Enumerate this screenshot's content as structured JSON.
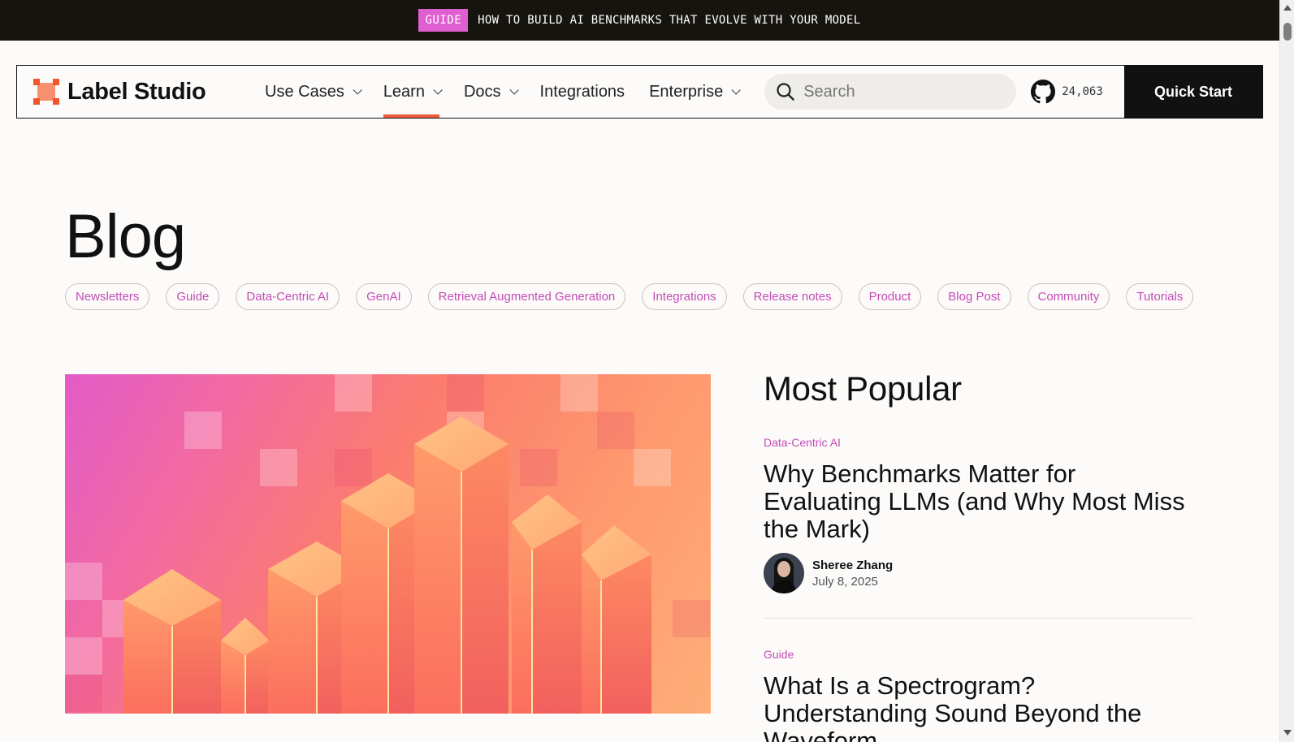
{
  "announcement": {
    "tag": "GUIDE",
    "message": "HOW TO BUILD AI BENCHMARKS THAT EVOLVE WITH YOUR MODEL"
  },
  "nav": {
    "brand": "Label Studio",
    "menu": [
      {
        "label": "Use Cases",
        "dropdown": true
      },
      {
        "label": "Learn",
        "dropdown": true,
        "active": true
      },
      {
        "label": "Docs",
        "dropdown": true
      },
      {
        "label": "Integrations",
        "dropdown": false
      },
      {
        "label": "Enterprise",
        "dropdown": true
      }
    ],
    "search_placeholder": "Search",
    "github_stars": "24,063",
    "cta": "Quick Start"
  },
  "page": {
    "title": "Blog",
    "tags": [
      "Newsletters",
      "Guide",
      "Data-Centric AI",
      "GenAI",
      "Retrieval Augmented Generation",
      "Integrations",
      "Release notes",
      "Product",
      "Blog Post",
      "Community",
      "Tutorials"
    ]
  },
  "popular": {
    "heading": "Most Popular",
    "posts": [
      {
        "category": "Data-Centric AI",
        "title": "Why Benchmarks Matter for Evaluating LLMs (and Why Most Miss the Mark)",
        "author": "Sheree Zhang",
        "date": "July 8, 2025"
      },
      {
        "category": "Guide",
        "title": "What Is a Spectrogram? Understanding Sound Beyond the Waveform"
      }
    ]
  },
  "colors": {
    "accent_pink": "#c34bb5",
    "accent_orange": "#ef5a3a",
    "dark": "#111111"
  }
}
